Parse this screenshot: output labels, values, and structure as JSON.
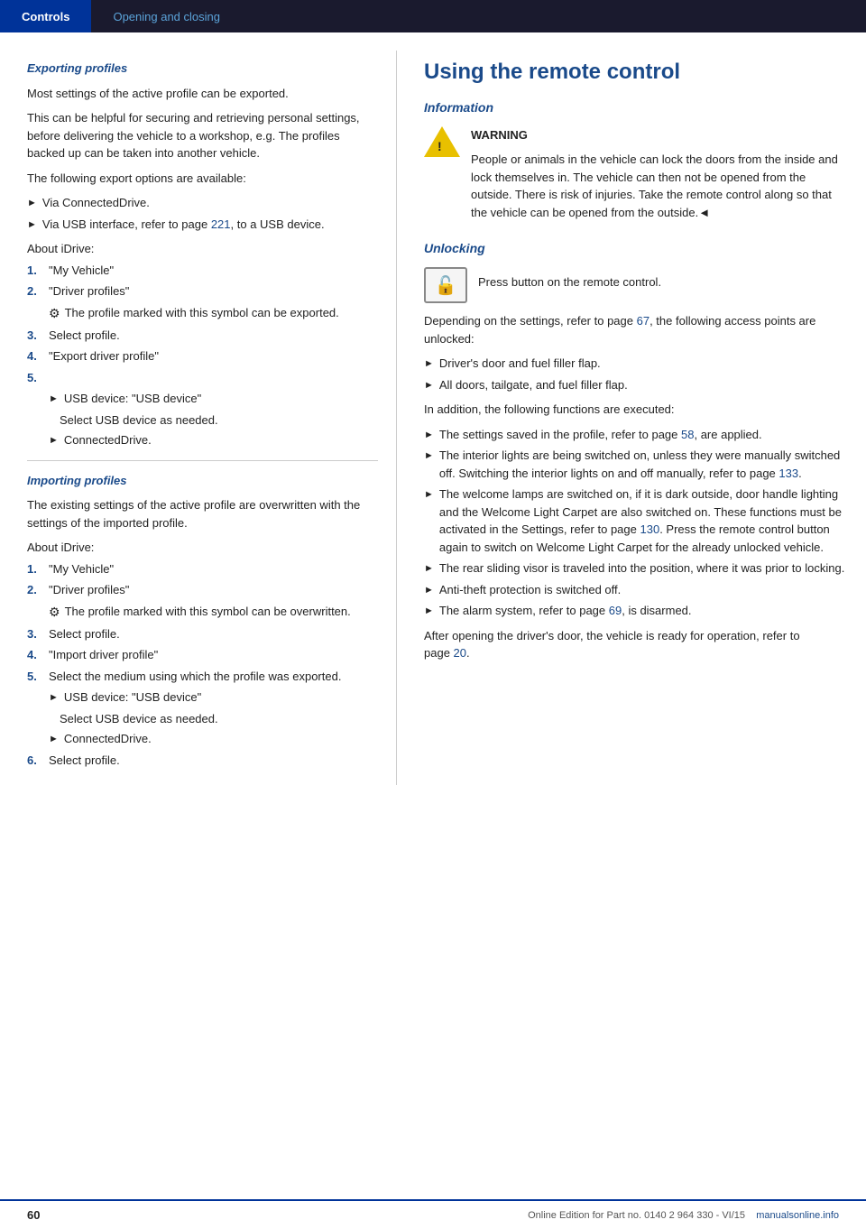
{
  "nav": {
    "item1": "Controls",
    "item2": "Opening and closing"
  },
  "left": {
    "section1_title": "Exporting profiles",
    "export_p1": "Most settings of the active profile can be exported.",
    "export_p2": "This can be helpful for securing and retrieving personal settings, before delivering the vehicle to a workshop, e.g. The profiles backed up can be taken into another vehicle.",
    "export_p3": "The following export options are available:",
    "export_bullets": [
      "Via ConnectedDrive.",
      "Via USB interface, refer to page 221, to a USB device."
    ],
    "export_page_ref": "221",
    "about_idrive": "About iDrive:",
    "export_steps": [
      {
        "num": "1.",
        "text": "\"My Vehicle\""
      },
      {
        "num": "2.",
        "text": "\"Driver profiles\""
      },
      {
        "num": "2a",
        "icon": "⚙",
        "text": "The profile marked with this symbol can be exported."
      },
      {
        "num": "3.",
        "text": "Select profile."
      },
      {
        "num": "4.",
        "text": "\"Export driver profile\""
      },
      {
        "num": "5.",
        "text": ""
      },
      {
        "num": "5a",
        "sub": "USB device: \"USB device\""
      },
      {
        "num": "5a2",
        "sub2": "Select USB device as needed."
      },
      {
        "num": "5b",
        "sub": "ConnectedDrive."
      }
    ],
    "section2_title": "Importing profiles",
    "import_p1": "The existing settings of the active profile are overwritten with the settings of the imported profile.",
    "about_idrive2": "About iDrive:",
    "import_steps": [
      {
        "num": "1.",
        "text": "\"My Vehicle\""
      },
      {
        "num": "2.",
        "text": "\"Driver profiles\""
      },
      {
        "num": "2a",
        "icon": "⚙",
        "text": "The profile marked with this symbol can be overwritten."
      },
      {
        "num": "3.",
        "text": "Select profile."
      },
      {
        "num": "4.",
        "text": "\"Import driver profile\""
      },
      {
        "num": "5.",
        "text": "Select the medium using which the profile was exported."
      },
      {
        "num": "5a",
        "sub": "USB device: \"USB device\""
      },
      {
        "num": "5a2",
        "sub2": "Select USB device as needed."
      },
      {
        "num": "5b",
        "sub": "ConnectedDrive."
      },
      {
        "num": "6.",
        "text": "Select profile."
      }
    ]
  },
  "right": {
    "main_title": "Using the remote control",
    "info_title": "Information",
    "warning_label": "WARNING",
    "warning_text": "People or animals in the vehicle can lock the doors from the inside and lock themselves in. The vehicle can then not be opened from the outside. There is risk of injuries. Take the remote control along so that the vehicle can be opened from the outside.◄",
    "unlocking_title": "Unlocking",
    "unlock_instruction": "Press button on the remote control.",
    "unlock_p1_pre": "Depending on the settings, refer to page ",
    "unlock_p1_ref": "67",
    "unlock_p1_post": ", the following access points are unlocked:",
    "unlock_bullets": [
      "Driver's door and fuel filler flap.",
      "All doors, tailgate, and fuel filler flap."
    ],
    "functions_p": "In addition, the following functions are executed:",
    "function_bullets": [
      {
        "text_pre": "The settings saved in the profile, refer to page ",
        "ref": "58",
        "text_post": ", are applied."
      },
      {
        "text_pre": "The interior lights are being switched on, unless they were manually switched off. Switching the interior lights on and off manually, refer to page ",
        "ref": "133",
        "text_post": "."
      },
      {
        "text_pre": "The welcome lamps are switched on, if it is dark outside, door handle lighting and the Welcome Light Carpet are also switched on. These functions must be activated in the Settings, refer to page ",
        "ref": "130",
        "text_post": ". Press the remote control button again to switch on Welcome Light Carpet for the already unlocked vehicle."
      },
      {
        "text_pre": "The rear sliding visor is traveled into the position, where it was prior to locking.",
        "ref": "",
        "text_post": ""
      },
      {
        "text_pre": "Anti-theft protection is switched off.",
        "ref": "",
        "text_post": ""
      },
      {
        "text_pre": "The alarm system, refer to page ",
        "ref": "69",
        "text_post": ", is disarmed."
      }
    ],
    "after_p_pre": "After opening the driver's door, the vehicle is ready for operation, refer to page ",
    "after_p_ref": "20",
    "after_p_post": "."
  },
  "footer": {
    "page_number": "60",
    "footer_text": "Online Edition for Part no. 0140 2 964 330 - VI/15",
    "site": "manualsonline.info"
  }
}
